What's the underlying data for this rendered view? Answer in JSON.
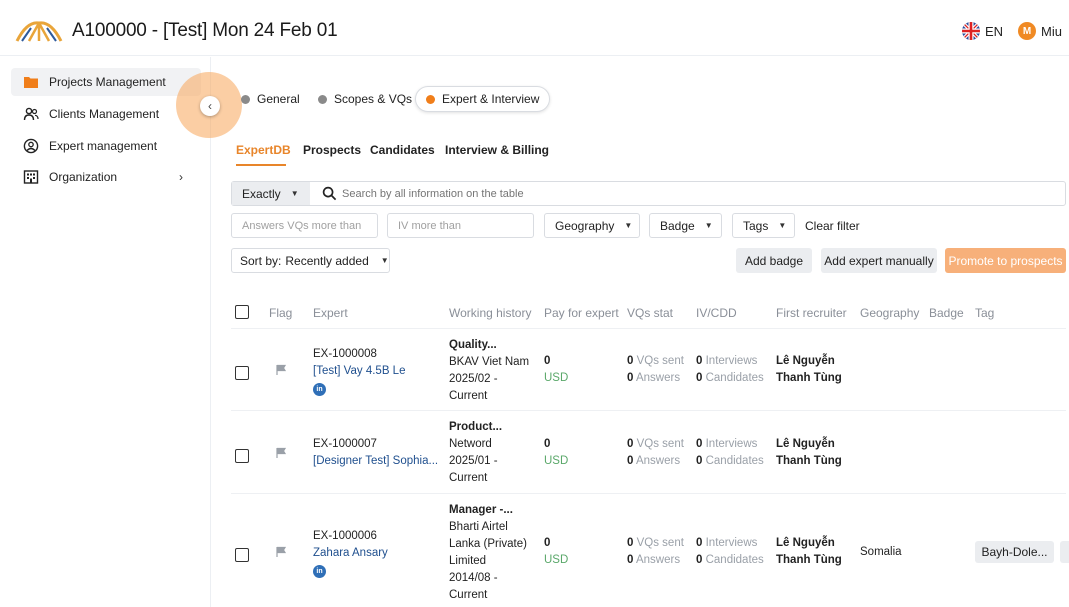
{
  "header": {
    "title": "A100000 - [Test] Mon 24 Feb 01",
    "language": "EN",
    "user_initial": "M",
    "user_name": "Miu"
  },
  "sidebar": {
    "items": [
      {
        "label": "Projects Management",
        "icon": "folder-icon",
        "active": true
      },
      {
        "label": "Clients Management",
        "icon": "users-icon"
      },
      {
        "label": "Expert management",
        "icon": "user-circle-icon"
      },
      {
        "label": "Organization",
        "icon": "building-icon",
        "has_children": true
      }
    ]
  },
  "steps": [
    {
      "label": "General"
    },
    {
      "label": "Scopes & VQs"
    },
    {
      "label": "Expert & Interview",
      "active": true
    }
  ],
  "subtabs": [
    "ExpertDB",
    "Prospects",
    "Candidates",
    "Interview & Billing"
  ],
  "search": {
    "mode": "Exactly",
    "placeholder": "Search by all information on the table"
  },
  "filters": {
    "answers_placeholder": "Answers VQs more than",
    "iv_placeholder": "IV more than",
    "geography": "Geography",
    "badge": "Badge",
    "tags": "Tags",
    "clear": "Clear filter"
  },
  "sort": {
    "label": "Sort by:",
    "value": "Recently added"
  },
  "actions": {
    "add_badge": "Add badge",
    "add_expert": "Add expert manually",
    "promote": "Promote to prospects"
  },
  "colors": {
    "accent": "#e8852a",
    "link": "#1f4f8e",
    "usd": "#5aa86a"
  },
  "table": {
    "columns": [
      "Flag",
      "Expert",
      "Working history",
      "Pay for expert",
      "VQs stat",
      "IV/CDD",
      "First recruiter",
      "Geography",
      "Badge",
      "Tag"
    ],
    "rows": [
      {
        "id": "EX-1000008",
        "name": "[Test] Vay 4.5B Le",
        "linkedin": true,
        "history": [
          "Quality...",
          "BKAV Viet Nam",
          "2025/02 -",
          "Current"
        ],
        "pay": "0",
        "currency": "USD",
        "vqs_sent": "0",
        "vqs_sent_label": "VQs sent",
        "answers": "0",
        "answers_label": "Answers",
        "interviews": "0",
        "interviews_label": "Interviews",
        "candidates": "0",
        "candidates_label": "Candidates",
        "recruiter": [
          "Lê Nguyễn",
          "Thanh Tùng"
        ],
        "geography": "",
        "tag": ""
      },
      {
        "id": "EX-1000007",
        "name": "[Designer Test] Sophia...",
        "linkedin": false,
        "history": [
          "Product...",
          "Netword",
          "2025/01 -",
          "Current"
        ],
        "pay": "0",
        "currency": "USD",
        "vqs_sent": "0",
        "vqs_sent_label": "VQs sent",
        "answers": "0",
        "answers_label": "Answers",
        "interviews": "0",
        "interviews_label": "Interviews",
        "candidates": "0",
        "candidates_label": "Candidates",
        "recruiter": [
          "Lê Nguyễn",
          "Thanh Tùng"
        ],
        "geography": "",
        "tag": ""
      },
      {
        "id": "EX-1000006",
        "name": "Zahara Ansary",
        "linkedin": true,
        "history": [
          "Manager -...",
          "Bharti Airtel",
          "Lanka (Private)",
          "Limited",
          "2014/08 -",
          "Current"
        ],
        "pay": "0",
        "currency": "USD",
        "vqs_sent": "0",
        "vqs_sent_label": "VQs sent",
        "answers": "0",
        "answers_label": "Answers",
        "interviews": "0",
        "interviews_label": "Interviews",
        "candidates": "0",
        "candidates_label": "Candidates",
        "recruiter": [
          "Lê Nguyễn",
          "Thanh Tùng"
        ],
        "geography": "Somalia",
        "tag": "Bayh-Dole..."
      }
    ]
  }
}
